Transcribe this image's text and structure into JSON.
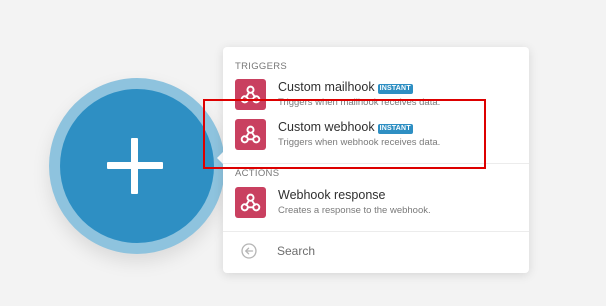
{
  "add_button": {
    "icon": "plus-icon",
    "color": "#2e8fc3"
  },
  "panel": {
    "sections": {
      "triggers_label": "TRIGGERS",
      "actions_label": "ACTIONS"
    },
    "triggers": [
      {
        "title": "Custom mailhook",
        "badge": "INSTANT",
        "description": "Triggers when mailhook receives data.",
        "icon": "webhook-icon"
      },
      {
        "title": "Custom webhook",
        "badge": "INSTANT",
        "description": "Triggers when webhook receives data.",
        "icon": "webhook-icon"
      }
    ],
    "actions": [
      {
        "title": "Webhook response",
        "description": "Creates a response to the webhook.",
        "icon": "webhook-icon"
      }
    ],
    "search": {
      "placeholder": "Search",
      "value": "",
      "back_icon": "back-arrow-icon"
    }
  },
  "colors": {
    "accent": "#2e8fc3",
    "module_icon_bg": "#c94060",
    "highlight": "#dd0000"
  }
}
